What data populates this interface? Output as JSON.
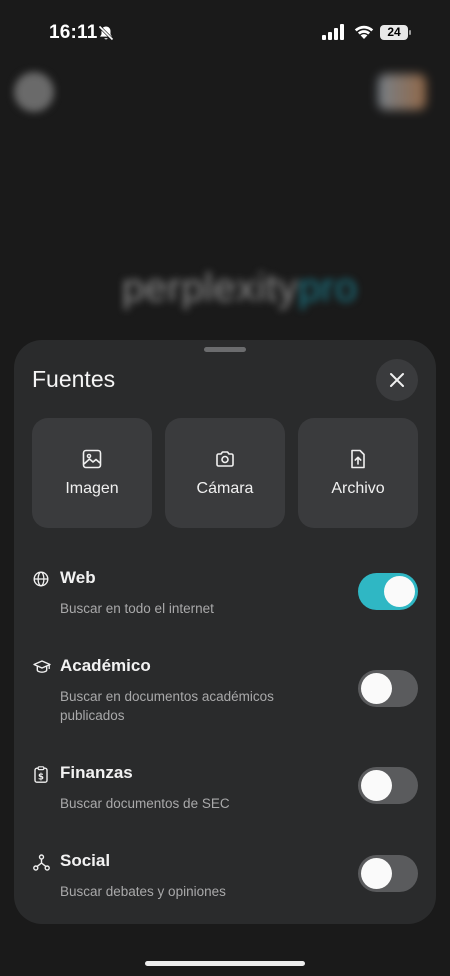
{
  "status_bar": {
    "time": "16:11",
    "battery": "24"
  },
  "background": {
    "logo_text": "perplexity",
    "logo_suffix": "pro"
  },
  "sheet": {
    "title": "Fuentes",
    "source_buttons": [
      {
        "label": "Imagen",
        "icon": "image-icon"
      },
      {
        "label": "Cámara",
        "icon": "camera-icon"
      },
      {
        "label": "Archivo",
        "icon": "file-upload-icon"
      }
    ],
    "options": [
      {
        "title": "Web",
        "description": "Buscar en todo el internet",
        "enabled": true,
        "icon": "globe-icon"
      },
      {
        "title": "Académico",
        "description": "Buscar en documentos académicos publicados",
        "enabled": false,
        "icon": "graduation-cap-icon"
      },
      {
        "title": "Finanzas",
        "description": "Buscar documentos de SEC",
        "enabled": false,
        "icon": "dollar-document-icon"
      },
      {
        "title": "Social",
        "description": "Buscar debates y opiniones",
        "enabled": false,
        "icon": "network-icon"
      }
    ]
  },
  "colors": {
    "accent": "#2fb7c4",
    "sheet": "#2a2b2c",
    "button": "#3a3b3d"
  }
}
